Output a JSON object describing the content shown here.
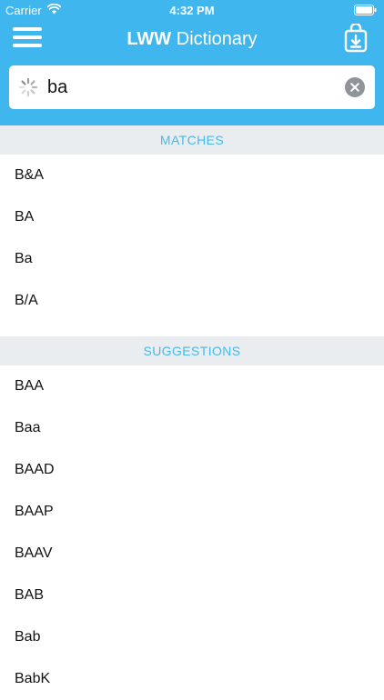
{
  "status_bar": {
    "carrier": "Carrier",
    "time": "4:32 PM"
  },
  "nav": {
    "title_brand": "LWW",
    "title_rest": " Dictionary",
    "menu_icon": "hamburger-menu-icon",
    "download_icon": "download-bag-icon"
  },
  "search": {
    "value": "ba",
    "placeholder": ""
  },
  "matches": {
    "header": "MATCHES",
    "items": [
      "B&A",
      "BA",
      "Ba",
      "B/A"
    ]
  },
  "suggestions": {
    "header": "SUGGESTIONS",
    "items": [
      "BAA",
      "Baa",
      "BAAD",
      "BAAP",
      "BAAV",
      "BAB",
      "Bab",
      "BabK"
    ]
  },
  "colors": {
    "accent": "#3fb6ee",
    "section_header_text": "#49b8e8",
    "section_header_bg": "#e9edf0"
  }
}
